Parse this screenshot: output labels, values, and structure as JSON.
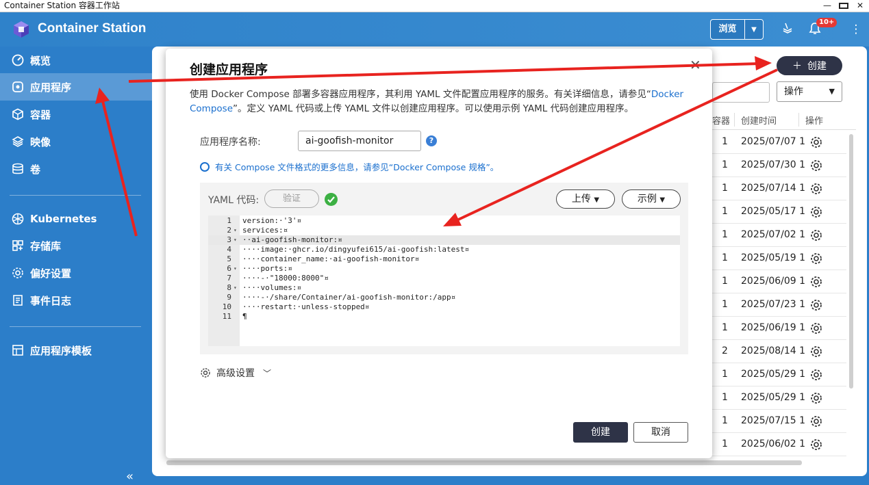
{
  "os": {
    "title": "Container Station 容器工作站"
  },
  "header": {
    "app_name": "Container Station",
    "browse_label": "浏览",
    "notification_badge": "10+"
  },
  "sidebar": {
    "items": [
      {
        "label": "概览",
        "icon": "dashboard-icon"
      },
      {
        "label": "应用程序",
        "icon": "app-icon"
      },
      {
        "label": "容器",
        "icon": "container-icon"
      },
      {
        "label": "映像",
        "icon": "image-layers-icon"
      },
      {
        "label": "卷",
        "icon": "volume-icon"
      },
      {
        "label": "Kubernetes",
        "icon": "kubernetes-icon"
      },
      {
        "label": "存储库",
        "icon": "repository-icon"
      },
      {
        "label": "偏好设置",
        "icon": "settings-icon"
      },
      {
        "label": "事件日志",
        "icon": "log-icon"
      },
      {
        "label": "应用程序模板",
        "icon": "template-icon"
      }
    ],
    "active_index": 1
  },
  "main": {
    "create_label": "创建",
    "operation_select": "操作",
    "columns": {
      "containers": "容器",
      "created": "创建时间",
      "actions": "操作"
    },
    "rows": [
      {
        "count": "1",
        "created": "2025/07/07 1"
      },
      {
        "count": "1",
        "created": "2025/07/30 1"
      },
      {
        "count": "1",
        "created": "2025/07/14 1"
      },
      {
        "count": "1",
        "created": "2025/05/17 1"
      },
      {
        "count": "1",
        "created": "2025/07/02 1"
      },
      {
        "count": "1",
        "created": "2025/05/19 1"
      },
      {
        "count": "1",
        "created": "2025/06/09 1"
      },
      {
        "count": "1",
        "created": "2025/07/23 1"
      },
      {
        "count": "1",
        "created": "2025/06/19 1"
      },
      {
        "count": "2",
        "created": "2025/08/14 1"
      },
      {
        "count": "1",
        "created": "2025/05/29 1"
      },
      {
        "count": "1",
        "created": "2025/05/29 1"
      },
      {
        "count": "1",
        "created": "2025/07/15 1"
      },
      {
        "count": "1",
        "created": "2025/06/02 1"
      }
    ]
  },
  "modal": {
    "title": "创建应用程序",
    "desc_part1": "使用 Docker Compose 部署多容器应用程序，其利用 YAML 文件配置应用程序的服务。有关详细信息，请参见“",
    "desc_link": "Docker Compose",
    "desc_part2": "”。定义 YAML 代码或上传 YAML 文件以创建应用程序。可以使用示例 YAML 代码创建应用程序。",
    "name_label": "应用程序名称:",
    "name_value": "ai-goofish-monitor",
    "info_text": "有关 Compose 文件格式的更多信息，请参见“Docker Compose 规格”。",
    "yaml_label": "YAML 代码:",
    "verify_label": "验证",
    "upload_label": "上传",
    "example_label": "示例",
    "advanced_label": "高级设置",
    "create_label": "创建",
    "cancel_label": "取消",
    "code_lines": [
      {
        "n": "1",
        "text": "version:·'3'¤"
      },
      {
        "n": "2",
        "text": "services:¤"
      },
      {
        "n": "3",
        "text": "··ai-goofish-monitor:¤"
      },
      {
        "n": "4",
        "text": "····image:·ghcr.io/dingyufei615/ai-goofish:latest¤"
      },
      {
        "n": "5",
        "text": "····container_name:·ai-goofish-monitor¤"
      },
      {
        "n": "6",
        "text": "····ports:¤"
      },
      {
        "n": "7",
        "text": "····-·\"18000:8000\"¤"
      },
      {
        "n": "8",
        "text": "····volumes:¤"
      },
      {
        "n": "9",
        "text": "····-·/share/Container/ai-goofish-monitor:/app¤"
      },
      {
        "n": "10",
        "text": "····restart:·unless-stopped¤"
      },
      {
        "n": "11",
        "text": "¶"
      }
    ]
  },
  "colors": {
    "brand_blue": "#2c7ec9",
    "dark_button": "#2e3347",
    "annotation_red": "#e8231f"
  }
}
